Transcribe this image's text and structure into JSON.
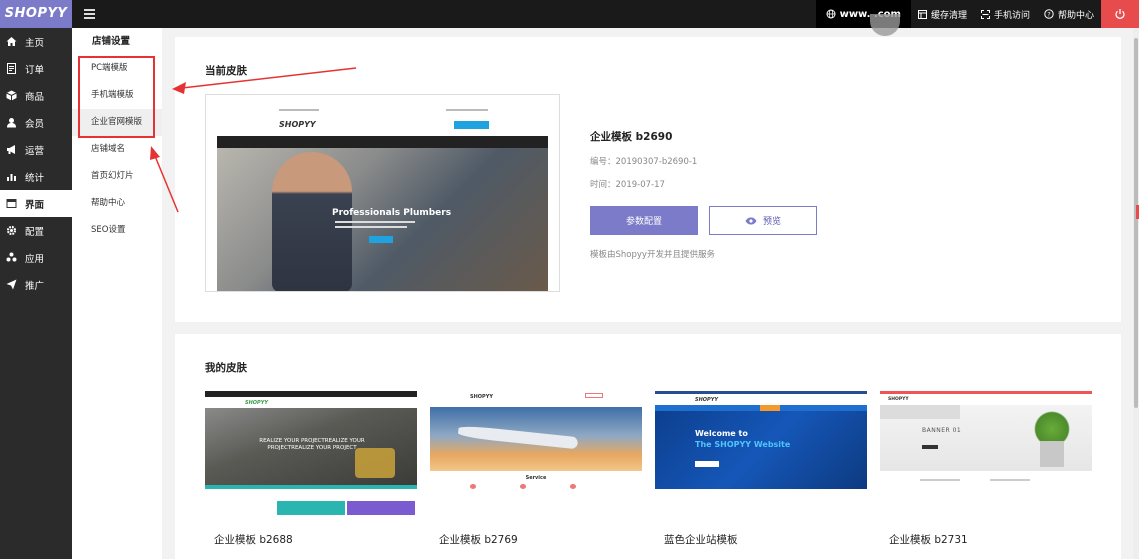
{
  "brand": {
    "logo": "SHOPYY",
    "accent": "#7b7bc9"
  },
  "topbar": {
    "site_url": "www.        .com",
    "items": [
      {
        "label": "缓存清理",
        "icon": "cache-clear-icon"
      },
      {
        "label": "手机访问",
        "icon": "mobile-scan-icon"
      },
      {
        "label": "帮助中心",
        "icon": "help-circle-icon"
      }
    ],
    "power_color": "#e84b4b"
  },
  "sidebar": {
    "items": [
      {
        "label": "主页",
        "icon": "home-icon"
      },
      {
        "label": "订单",
        "icon": "order-icon"
      },
      {
        "label": "商品",
        "icon": "box-icon"
      },
      {
        "label": "会员",
        "icon": "user-icon"
      },
      {
        "label": "运营",
        "icon": "megaphone-icon"
      },
      {
        "label": "统计",
        "icon": "chart-icon"
      },
      {
        "label": "界面",
        "icon": "layout-icon"
      },
      {
        "label": "配置",
        "icon": "gear-icon"
      },
      {
        "label": "应用",
        "icon": "apps-icon"
      },
      {
        "label": "推广",
        "icon": "send-icon"
      }
    ],
    "active": "界面"
  },
  "subnav": {
    "title": "店铺设置",
    "items": [
      "PC端模版",
      "手机端模版",
      "企业官网模版",
      "店铺域名",
      "首页幻灯片",
      "帮助中心",
      "SEO设置"
    ],
    "active": "企业官网模版"
  },
  "current_skin": {
    "title": "当前皮肤",
    "name": "企业模板 b2690",
    "code": "编号：20190307-b2690-1",
    "time": "时间：2019-07-17",
    "config_button": "参数配置",
    "preview_button": "预览",
    "note": "模板由Shopyy开发并且提供服务",
    "thumb": {
      "logo": "SHOPYY",
      "hero_title": "Professionals Plumbers"
    }
  },
  "my_skins": {
    "title": "我的皮肤",
    "items": [
      {
        "caption": "企业模板 b2688",
        "thumb_logo": "SHOPYY",
        "thumb_text": "REALIZE YOUR PROJECTREALIZE YOUR PROJECTREALIZE YOUR PROJECT"
      },
      {
        "caption": "企业模板 b2769",
        "thumb_logo": "SHOPYY",
        "thumb_text": "Service"
      },
      {
        "caption": "蓝色企业站模板",
        "thumb_logo": "SHOPYY",
        "thumb_text": "Welcome to",
        "thumb_text2": "The SHOPYY  Website"
      },
      {
        "caption": "企业模板 b2731",
        "thumb_logo": "SHOPYY",
        "thumb_text": "BANNER 01"
      }
    ]
  }
}
